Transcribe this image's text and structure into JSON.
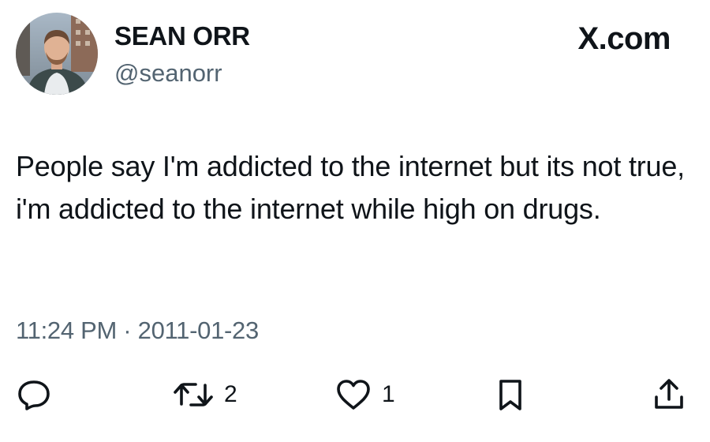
{
  "author": {
    "display_name": "SEAN ORR",
    "handle": "@seanorr",
    "avatar_icon": "profile-photo"
  },
  "brand": {
    "label": "X.com"
  },
  "tweet": {
    "text": "People say I'm addicted to the internet but its not true, i'm addicted to the internet while high on drugs.",
    "timestamp": "11:24 PM · 2011-01-23"
  },
  "actions": {
    "reply": {
      "icon": "reply-icon"
    },
    "retweet": {
      "icon": "retweet-icon",
      "count": "2"
    },
    "like": {
      "icon": "heart-icon",
      "count": "1"
    },
    "bookmark": {
      "icon": "bookmark-icon"
    },
    "share": {
      "icon": "share-icon"
    }
  },
  "colors": {
    "text": "#0f1419",
    "secondary": "#536471",
    "background": "#ffffff"
  }
}
